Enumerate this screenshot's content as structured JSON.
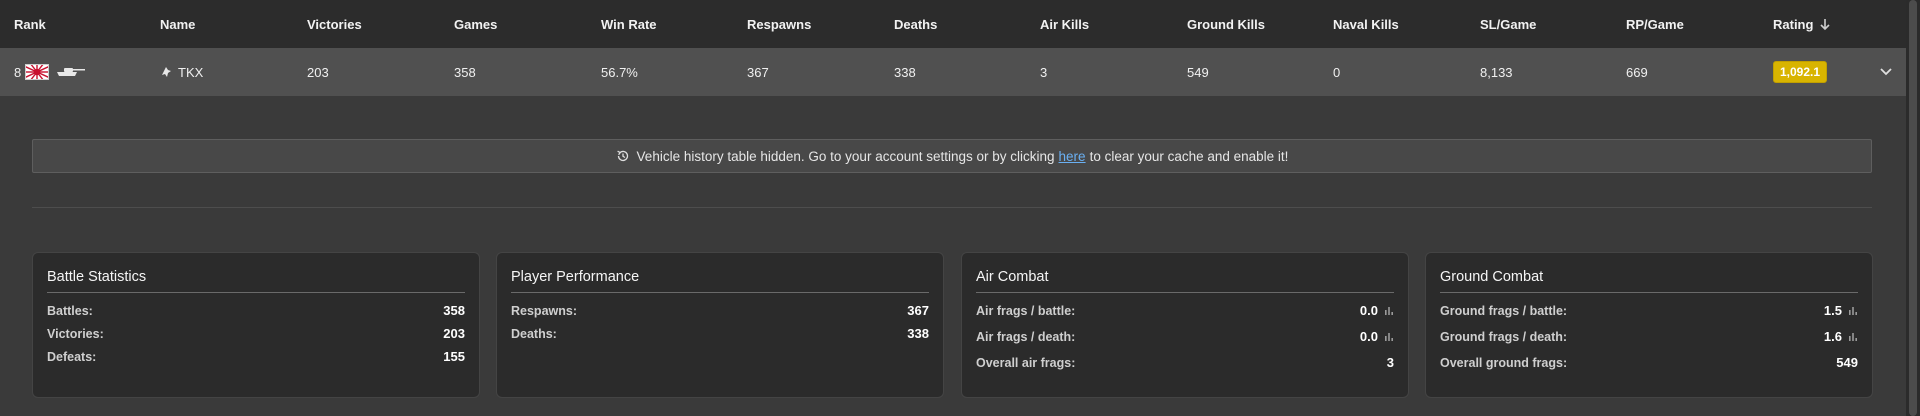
{
  "table": {
    "headers": [
      "Rank",
      "Name",
      "Victories",
      "Games",
      "Win Rate",
      "Respawns",
      "Deaths",
      "Air Kills",
      "Ground Kills",
      "Naval Kills",
      "SL/Game",
      "RP/Game",
      "Rating"
    ],
    "sort_icon": "arrow-down-icon",
    "row": {
      "rank": "8",
      "name": "TKX",
      "victories": "203",
      "games": "358",
      "win_rate": "56.7%",
      "respawns": "367",
      "deaths": "338",
      "air_kills": "3",
      "ground_kills": "549",
      "naval_kills": "0",
      "sl_game": "8,133",
      "rp_game": "669",
      "rating": "1,092.1"
    }
  },
  "notice": {
    "text_before": "Vehicle history table hidden. Go to your account settings or by clicking",
    "link_text": "here",
    "text_after": "to clear your cache and enable it!"
  },
  "cards": {
    "battle": {
      "title": "Battle Statistics",
      "rows": [
        {
          "label": "Battles:",
          "value": "358"
        },
        {
          "label": "Victories:",
          "value": "203"
        },
        {
          "label": "Defeats:",
          "value": "155"
        }
      ]
    },
    "performance": {
      "title": "Player Performance",
      "rows": [
        {
          "label": "Respawns:",
          "value": "367"
        },
        {
          "label": "Deaths:",
          "value": "338"
        }
      ]
    },
    "air": {
      "title": "Air Combat",
      "rows": [
        {
          "label": "Air frags / battle:",
          "value": "0.0"
        },
        {
          "label": "Air frags / death:",
          "value": "0.0"
        },
        {
          "label": "Overall air frags:",
          "value": "3"
        }
      ]
    },
    "ground": {
      "title": "Ground Combat",
      "rows": [
        {
          "label": "Ground frags / battle:",
          "value": "1.5"
        },
        {
          "label": "Ground frags / death:",
          "value": "1.6"
        },
        {
          "label": "Overall ground frags:",
          "value": "549"
        }
      ]
    }
  },
  "colors": {
    "rating_badge": "#d8b400",
    "link": "#6ab0f3",
    "flag_red": "#c8102e"
  }
}
